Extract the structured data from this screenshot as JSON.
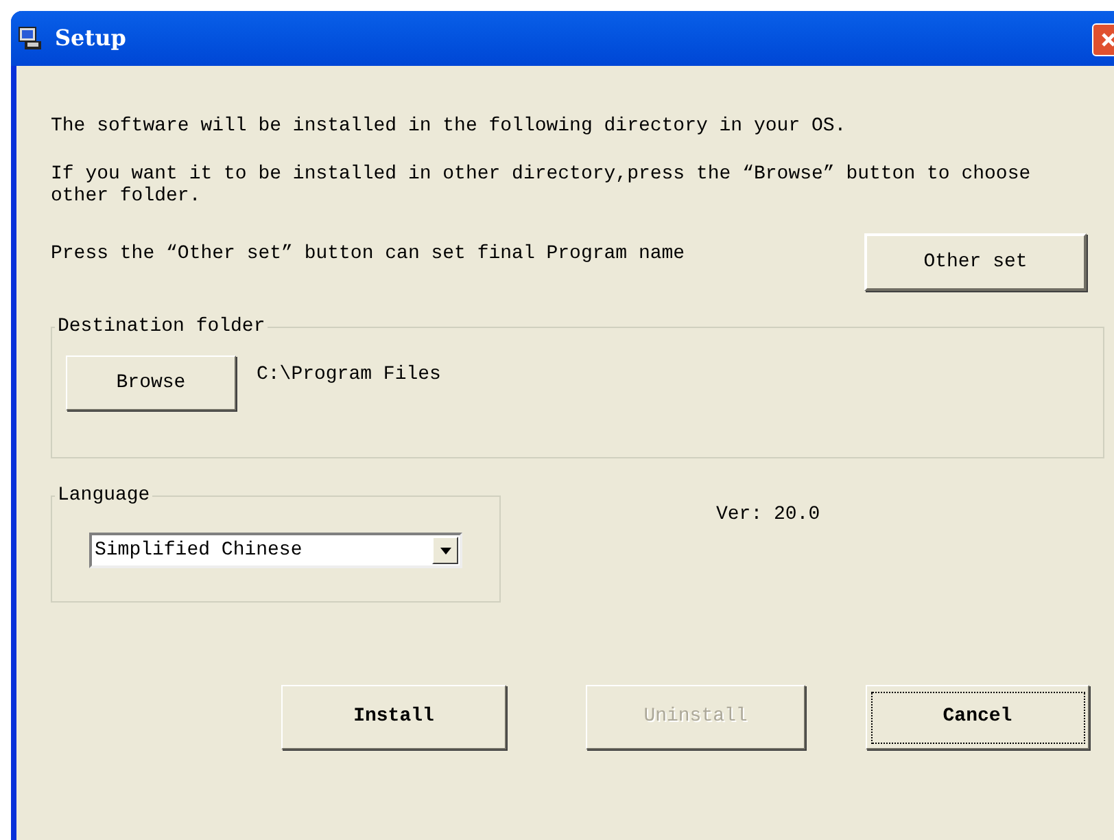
{
  "window": {
    "title": "Setup"
  },
  "intro": [
    "The software  will be installed in the following directory in your OS.",
    "If you want it to be installed in other directory,press the “Browse” button to choose other folder."
  ],
  "other_set": {
    "text": "Press the “Other set”  button can set final Program name",
    "button": "Other set"
  },
  "destination": {
    "legend": "Destination folder",
    "browse_button": "Browse",
    "path": "C:\\Program Files"
  },
  "language": {
    "legend": "Language",
    "value": "Simplified Chinese"
  },
  "version": "Ver: 20.0",
  "buttons": [
    {
      "label": "Install",
      "disabled": false,
      "focused": false
    },
    {
      "label": "Uninstall",
      "disabled": true,
      "focused": false
    },
    {
      "label": "Cancel",
      "disabled": false,
      "focused": true
    }
  ]
}
